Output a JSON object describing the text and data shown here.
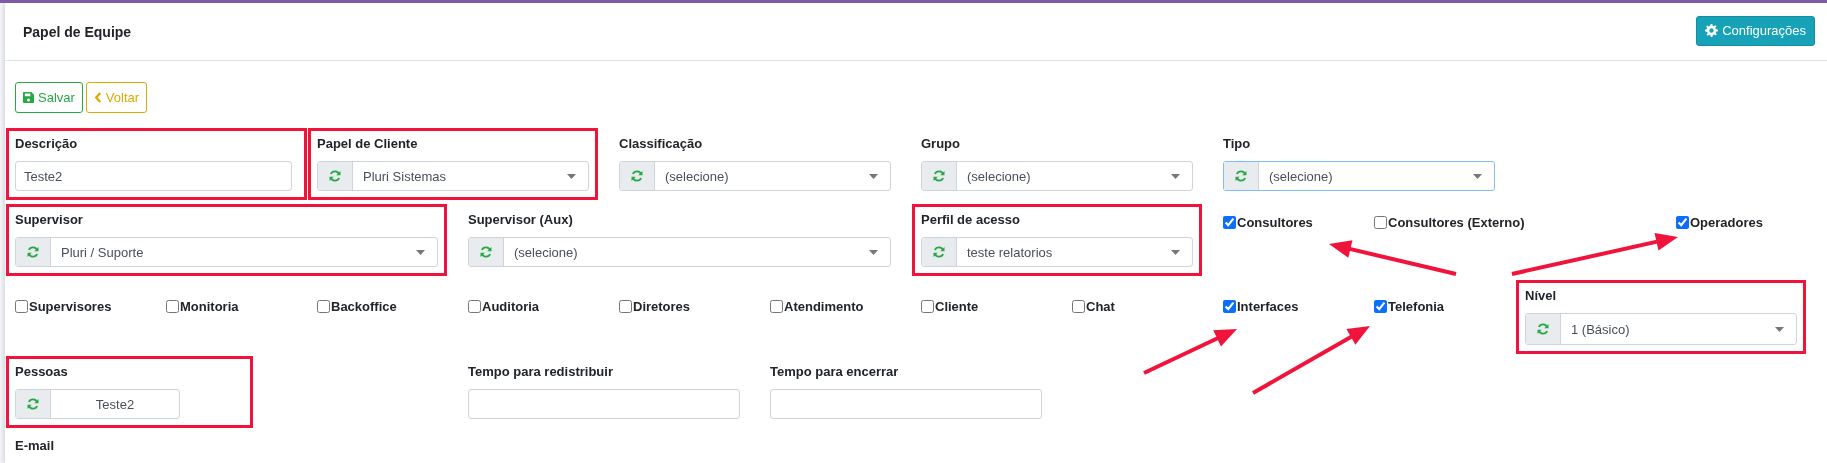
{
  "header": {
    "title": "Papel de Equipe",
    "settings_button": "Configurações"
  },
  "actions": [
    {
      "kind": "save",
      "label": "Salvar"
    },
    {
      "kind": "back",
      "label": "Voltar"
    }
  ],
  "rows": [
    [
      {
        "kind": "text",
        "label": "Descrição",
        "value": "Teste2",
        "highlighted": true
      },
      {
        "kind": "select",
        "label": "Papel de Cliente",
        "value": "Pluri Sistemas",
        "highlighted": true,
        "focused": false
      },
      {
        "kind": "select",
        "label": "Classificação",
        "value": "(selecione)",
        "highlighted": false,
        "focused": false
      },
      {
        "kind": "select",
        "label": "Grupo",
        "value": "(selecione)",
        "highlighted": false,
        "focused": false
      },
      {
        "kind": "select",
        "label": "Tipo",
        "value": "(selecione)",
        "highlighted": false,
        "focused": true
      }
    ],
    [
      {
        "kind": "select",
        "label": "Supervisor",
        "value": "Pluri / Suporte",
        "highlighted": true,
        "focused": false
      },
      {
        "kind": "select",
        "label": "Supervisor (Aux)",
        "value": "(selecione)",
        "highlighted": false,
        "focused": false
      },
      {
        "kind": "select",
        "label": "Perfil de acesso",
        "value": "teste relatorios",
        "highlighted": true,
        "focused": false
      },
      {
        "kind": "checkbox",
        "label": "Consultores",
        "checked": true
      },
      {
        "kind": "checkbox",
        "label": "Consultores (Externo)",
        "checked": false
      },
      {
        "kind": "checkbox",
        "label": "Operadores",
        "checked": true
      }
    ],
    [
      {
        "kind": "checkbox",
        "label": "Supervisores",
        "checked": false
      },
      {
        "kind": "checkbox",
        "label": "Monitoria",
        "checked": false
      },
      {
        "kind": "checkbox",
        "label": "Backoffice",
        "checked": false
      },
      {
        "kind": "checkbox",
        "label": "Auditoria",
        "checked": false
      },
      {
        "kind": "checkbox",
        "label": "Diretores",
        "checked": false
      },
      {
        "kind": "checkbox",
        "label": "Atendimento",
        "checked": false
      },
      {
        "kind": "checkbox",
        "label": "Cliente",
        "checked": false
      },
      {
        "kind": "checkbox",
        "label": "Chat",
        "checked": false
      },
      {
        "kind": "checkbox",
        "label": "Interfaces",
        "checked": true
      },
      {
        "kind": "checkbox",
        "label": "Telefonia",
        "checked": true
      },
      {
        "kind": "select",
        "label": "Nível",
        "value": "1 (Básico)",
        "highlighted": true,
        "focused": false
      }
    ],
    [
      {
        "kind": "lookup",
        "label": "Pessoas",
        "value": "Teste2",
        "highlighted": true
      },
      {
        "kind": "text",
        "label": "Tempo para redistribuir",
        "highlighted": false
      },
      {
        "kind": "text",
        "label": "Tempo para encerrar",
        "highlighted": false
      }
    ],
    [
      {
        "kind": "label",
        "label": "E-mail"
      }
    ]
  ]
}
